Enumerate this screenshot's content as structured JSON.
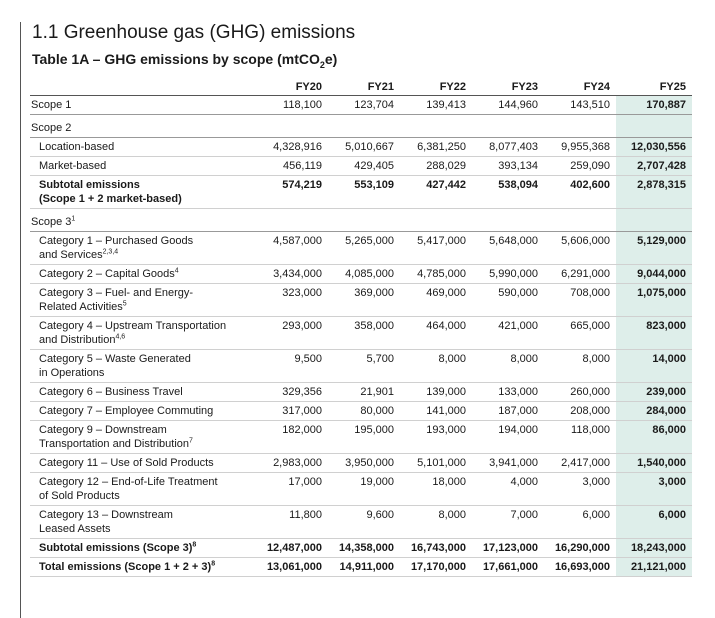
{
  "heading": "1.1 Greenhouse gas (GHG) emissions",
  "table_title": "Table 1A – GHG emissions by scope (mtCO",
  "table_title_sub": "2",
  "table_title_end": "e)",
  "columns": [
    "FY20",
    "FY21",
    "FY22",
    "FY23",
    "FY24",
    "FY25"
  ],
  "rows": {
    "scope1": {
      "label": "Scope 1",
      "values": [
        "118,100",
        "123,704",
        "139,413",
        "144,960",
        "143,510",
        "170,887"
      ]
    },
    "scope2_header": {
      "label": "Scope 2"
    },
    "location": {
      "label": "Location-based",
      "values": [
        "4,328,916",
        "5,010,667",
        "6,381,250",
        "8,077,403",
        "9,955,368",
        "12,030,556"
      ]
    },
    "market": {
      "label": "Market-based",
      "values": [
        "456,119",
        "429,405",
        "288,029",
        "393,134",
        "259,090",
        "2,707,428"
      ]
    },
    "subtotal2": {
      "label": "Subtotal emissions",
      "label2": "(Scope 1 + 2 market-based)",
      "values": [
        "574,219",
        "553,109",
        "427,442",
        "538,094",
        "402,600",
        "2,878,315"
      ]
    },
    "scope3_header": {
      "label": "Scope 3",
      "sup": "1"
    },
    "cat1": {
      "label": "Category 1 – Purchased Goods",
      "label2": "and Services",
      "sup": "2,3,4",
      "values": [
        "4,587,000",
        "5,265,000",
        "5,417,000",
        "5,648,000",
        "5,606,000",
        "5,129,000"
      ]
    },
    "cat2": {
      "label": "Category 2 – Capital Goods",
      "sup": "4",
      "values": [
        "3,434,000",
        "4,085,000",
        "4,785,000",
        "5,990,000",
        "6,291,000",
        "9,044,000"
      ]
    },
    "cat3": {
      "label": "Category 3 – Fuel- and Energy-",
      "label2": "Related Activities",
      "sup": "5",
      "values": [
        "323,000",
        "369,000",
        "469,000",
        "590,000",
        "708,000",
        "1,075,000"
      ]
    },
    "cat4": {
      "label": "Category 4 – Upstream Transportation",
      "label2": "and Distribution",
      "sup": "4,6",
      "values": [
        "293,000",
        "358,000",
        "464,000",
        "421,000",
        "665,000",
        "823,000"
      ]
    },
    "cat5": {
      "label": "Category 5 – Waste Generated",
      "label2": "in Operations",
      "values": [
        "9,500",
        "5,700",
        "8,000",
        "8,000",
        "8,000",
        "14,000"
      ]
    },
    "cat6": {
      "label": "Category 6 – Business Travel",
      "values": [
        "329,356",
        "21,901",
        "139,000",
        "133,000",
        "260,000",
        "239,000"
      ]
    },
    "cat7": {
      "label": "Category 7 – Employee Commuting",
      "values": [
        "317,000",
        "80,000",
        "141,000",
        "187,000",
        "208,000",
        "284,000"
      ]
    },
    "cat9": {
      "label": "Category 9 – Downstream",
      "label2": "Transportation and Distribution",
      "sup": "7",
      "values": [
        "182,000",
        "195,000",
        "193,000",
        "194,000",
        "118,000",
        "86,000"
      ]
    },
    "cat11": {
      "label": "Category 11 – Use of Sold Products",
      "values": [
        "2,983,000",
        "3,950,000",
        "5,101,000",
        "3,941,000",
        "2,417,000",
        "1,540,000"
      ]
    },
    "cat12": {
      "label": "Category 12 – End-of-Life Treatment",
      "label2": "of Sold Products",
      "values": [
        "17,000",
        "19,000",
        "18,000",
        "4,000",
        "3,000",
        "3,000"
      ]
    },
    "cat13": {
      "label": "Category 13 – Downstream",
      "label2": "Leased Assets",
      "values": [
        "11,800",
        "9,600",
        "8,000",
        "7,000",
        "6,000",
        "6,000"
      ]
    },
    "subtotal3": {
      "label": "Subtotal emissions (Scope 3)",
      "sup": "8",
      "values": [
        "12,487,000",
        "14,358,000",
        "16,743,000",
        "17,123,000",
        "16,290,000",
        "18,243,000"
      ]
    },
    "total": {
      "label": "Total emissions (Scope 1 + 2 + 3)",
      "sup": "8",
      "values": [
        "13,061,000",
        "14,911,000",
        "17,170,000",
        "17,661,000",
        "16,693,000",
        "21,121,000"
      ]
    }
  },
  "highlight_color": "#deeeea"
}
